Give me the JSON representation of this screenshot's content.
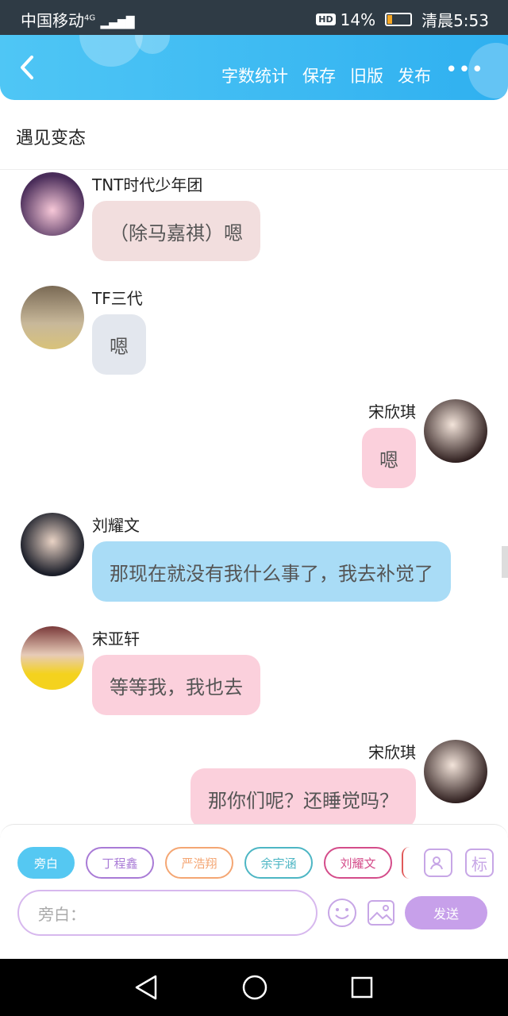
{
  "status": {
    "carrier": "中国移动",
    "net": "4G",
    "battery": "14%",
    "time": "清晨5:53",
    "hd": "HD",
    "battery_level": 0.14
  },
  "header": {
    "actions": [
      "字数统计",
      "保存",
      "旧版",
      "发布"
    ],
    "more": "•••"
  },
  "title": "遇见变态",
  "messages": [
    {
      "name": "TNT时代少年团",
      "text": "（除马嘉祺）嗯",
      "side": "left",
      "color": "#f2dede"
    },
    {
      "name": "TF三代",
      "text": "嗯",
      "side": "left",
      "color": "#e3e7ee"
    },
    {
      "name": "宋欣琪",
      "text": "嗯",
      "side": "right",
      "color": "#fbd0dc"
    },
    {
      "name": "刘耀文",
      "text": "那现在就没有我什么事了，我去补觉了",
      "side": "left",
      "color": "#a9dcf6"
    },
    {
      "name": "宋亚轩",
      "text": "等等我，我也去",
      "side": "left",
      "color": "#fbd0dc"
    },
    {
      "name": "宋欣琪",
      "text": "那你们呢？还睡觉吗？",
      "side": "right",
      "color": "#fbd0dc"
    }
  ],
  "composer": {
    "chips": [
      {
        "label": "旁白",
        "border": "#55c8f2",
        "color": "#fff",
        "bg": "#55c8f2"
      },
      {
        "label": "丁程鑫",
        "border": "#a97bd6",
        "color": "#a97bd6",
        "bg": "#fff"
      },
      {
        "label": "严浩翔",
        "border": "#f4a673",
        "color": "#f4a673",
        "bg": "#fff"
      },
      {
        "label": "余宇涵",
        "border": "#4db6c4",
        "color": "#4db6c4",
        "bg": "#fff"
      },
      {
        "label": "刘耀文",
        "border": "#d44c8a",
        "color": "#d44c8a",
        "bg": "#fff"
      }
    ],
    "tag_button": "标",
    "placeholder": "旁白：",
    "send": "发送"
  }
}
